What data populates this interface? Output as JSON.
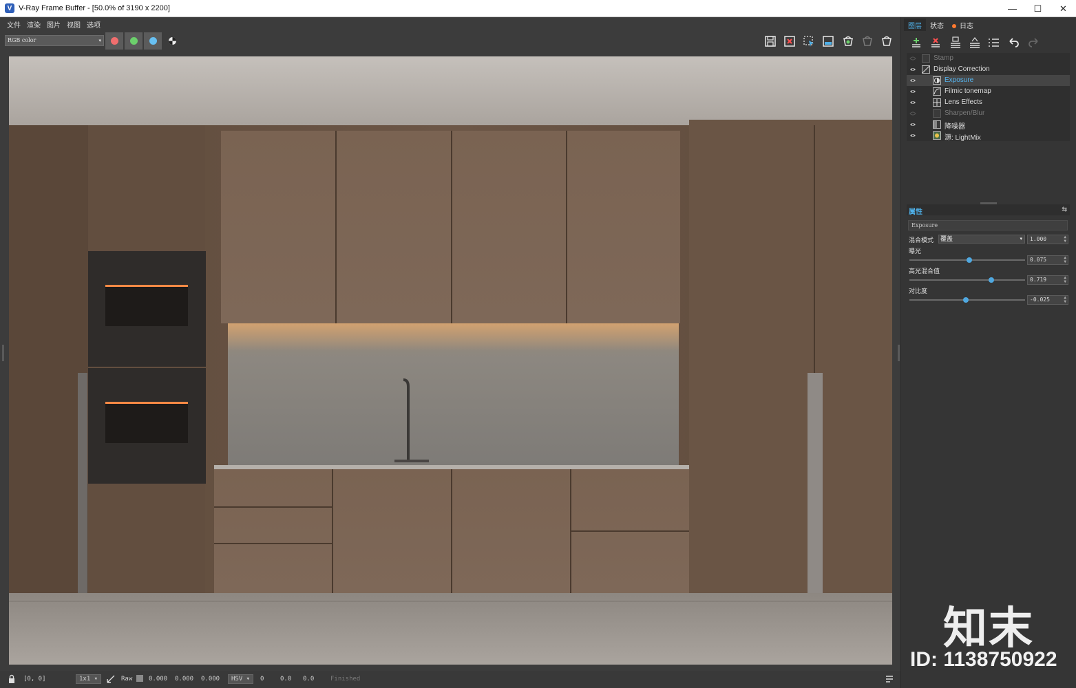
{
  "window": {
    "title": "V-Ray Frame Buffer - [50.0% of 3190 x 2200]",
    "app_icon": "V",
    "minimize": "—",
    "maximize": "☐",
    "close": "✕"
  },
  "menu": [
    "文件",
    "渲染",
    "图片",
    "视图",
    "选项"
  ],
  "toolbar": {
    "channel": "RGB color",
    "channel_colors": {
      "red": "#f06e6e",
      "green": "#6cd06c",
      "blue": "#68c0f2"
    },
    "icons": [
      "save-icon",
      "clear-image-icon",
      "region-render-icon",
      "compare-icon",
      "render-icon",
      "interactive-render-icon",
      "stop-render-icon"
    ]
  },
  "panel": {
    "tabs": [
      "图层",
      "状态",
      "日志"
    ],
    "layer_tools": [
      "add-layer-icon",
      "delete-layer-icon",
      "save-layers-icon",
      "load-layers-icon",
      "layer-list-icon",
      "undo-icon",
      "redo-icon"
    ],
    "layers": [
      {
        "name": "Stamp",
        "visible": false,
        "indent": 0
      },
      {
        "name": "Display Correction",
        "visible": true,
        "indent": 0
      },
      {
        "name": "Exposure",
        "visible": true,
        "indent": 1
      },
      {
        "name": "Filmic tonemap",
        "visible": true,
        "indent": 1
      },
      {
        "name": "Lens Effects",
        "visible": true,
        "indent": 1
      },
      {
        "name": "Sharpen/Blur",
        "visible": false,
        "indent": 1
      },
      {
        "name": "降噪器",
        "visible": true,
        "indent": 1
      },
      {
        "name": "源: LightMix",
        "visible": true,
        "indent": 1
      }
    ],
    "properties": {
      "title": "属性",
      "layer_name": "Exposure",
      "blend_label": "混合模式",
      "blend_mode": "覆盖",
      "blend_value": "1.000",
      "exposure_label": "曝光",
      "exposure_value": "0.075",
      "exposure_pos": 0.52,
      "highlight_label": "高光混合值",
      "highlight_value": "0.719",
      "highlight_pos": 0.71,
      "contrast_label": "对比度",
      "contrast_value": "-0.025",
      "contrast_pos": 0.49
    }
  },
  "status": {
    "coords": "[0, 0]",
    "zoom": "1x1",
    "mode": "Raw",
    "rgb": [
      "0.000",
      "0.000",
      "0.000"
    ],
    "color_space": "HSV",
    "hsv": [
      "0",
      "0.0",
      "0.0"
    ],
    "message": "Finished"
  },
  "watermark": {
    "brand": "知末",
    "id": "ID: 1138750922"
  }
}
